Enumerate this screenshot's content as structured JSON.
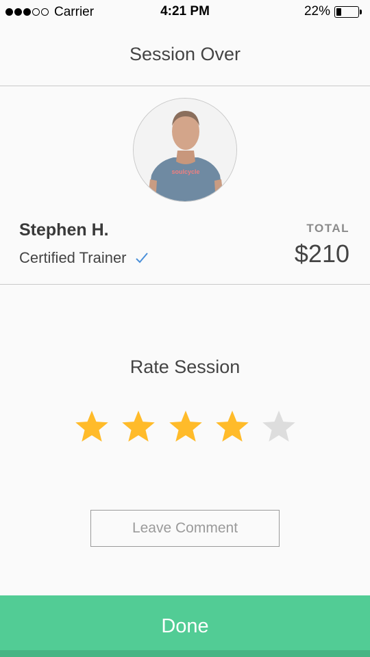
{
  "status_bar": {
    "signal_filled": 3,
    "signal_total": 5,
    "carrier": "Carrier",
    "time": "4:21 PM",
    "battery_percent": "22%",
    "battery_level": 0.22
  },
  "header": {
    "title": "Session Over"
  },
  "trainer": {
    "name": "Stephen H.",
    "certification": "Certified Trainer",
    "verified_icon": "checkmark-icon",
    "shirt_text": "soulcycle",
    "total_label": "TOTAL",
    "total_amount": "$210"
  },
  "rating": {
    "title": "Rate Session",
    "value": 4,
    "max": 5,
    "filled_color": "#ffbb2a",
    "empty_color": "#dddddd"
  },
  "comment_button": {
    "label": "Leave Comment"
  },
  "done_button": {
    "label": "Done",
    "color": "#52cc95"
  }
}
